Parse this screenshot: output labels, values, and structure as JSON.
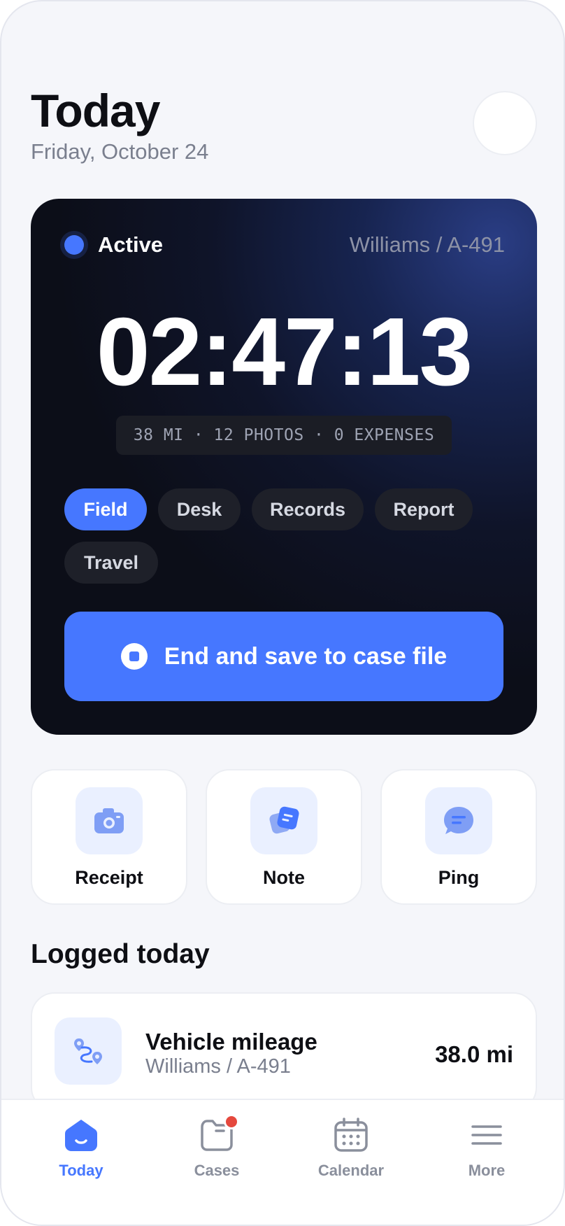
{
  "header": {
    "title": "Today",
    "date": "Friday, October 24"
  },
  "timer_card": {
    "status": "Active",
    "case_ref": "Williams / A-491",
    "elapsed": "02:47:13",
    "stats": "38 MI · 12 PHOTOS · 0 EXPENSES",
    "chips": [
      "Field",
      "Desk",
      "Records",
      "Report",
      "Travel"
    ],
    "active_chip": "Field",
    "end_button_label": "End and save to case file"
  },
  "quick_actions": [
    {
      "label": "Receipt",
      "icon": "camera-icon"
    },
    {
      "label": "Note",
      "icon": "note-icon"
    },
    {
      "label": "Ping",
      "icon": "chat-bubble-icon"
    }
  ],
  "logged_today": {
    "title": "Logged today",
    "items": [
      {
        "title": "Vehicle mileage",
        "subtitle": "Williams / A-491",
        "value": "38.0 mi",
        "icon": "route-icon"
      }
    ]
  },
  "tabbar": {
    "items": [
      {
        "label": "Today",
        "icon": "home-icon",
        "active": true
      },
      {
        "label": "Cases",
        "icon": "folder-icon",
        "badge": true
      },
      {
        "label": "Calendar",
        "icon": "calendar-icon"
      },
      {
        "label": "More",
        "icon": "menu-icon"
      }
    ]
  },
  "colors": {
    "accent": "#4677ff",
    "card_dark": "#0c0e18",
    "badge": "#e5483d",
    "muted": "#7a7f8e"
  }
}
